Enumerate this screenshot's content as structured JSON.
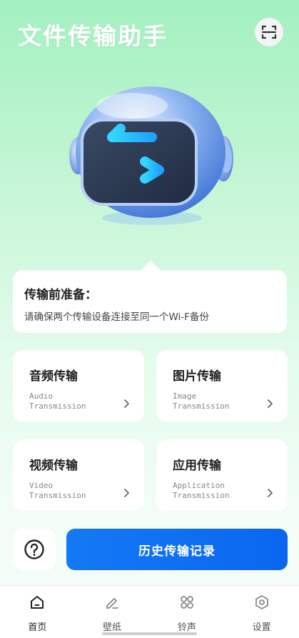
{
  "header": {
    "title": "文件传输助手",
    "scan_icon": "scan-icon"
  },
  "prep": {
    "title": "传输前准备：",
    "desc": "请确保两个传输设备连接至同一个Wi-F备份"
  },
  "cards": [
    {
      "title": "音频传输",
      "en": "Audio\nTransmission"
    },
    {
      "title": "图片传输",
      "en": "Image\nTransmission"
    },
    {
      "title": "视频传输",
      "en": "Video\nTransmission"
    },
    {
      "title": "应用传输",
      "en": "Application\nTransmission"
    }
  ],
  "history_button": "历史传输记录",
  "tabs": [
    {
      "label": "首页",
      "icon": "home-icon"
    },
    {
      "label": "壁纸",
      "icon": "pen-icon"
    },
    {
      "label": "铃声",
      "icon": "grid-icon"
    },
    {
      "label": "设置",
      "icon": "hexagon-settings-icon"
    }
  ],
  "colors": {
    "accent": "#0a6cf2",
    "background_top": "#a3f0c0",
    "background_bottom": "#f7fcf8"
  }
}
